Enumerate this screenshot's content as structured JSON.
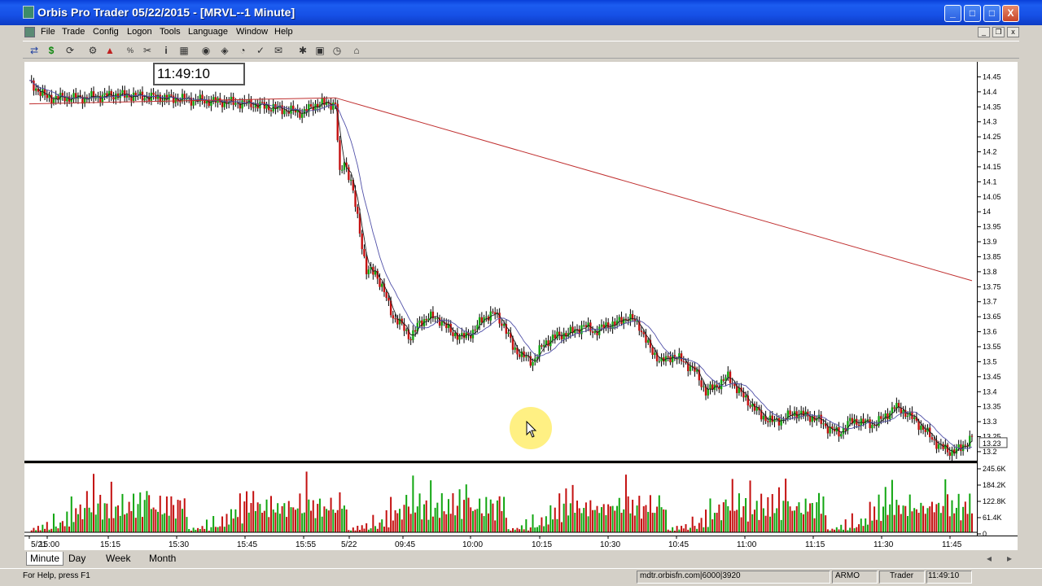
{
  "window": {
    "title": "Orbis Pro Trader  05/22/2015 - [MRVL--1 Minute]",
    "controls": [
      "_",
      "□",
      "X"
    ]
  },
  "menu": {
    "items": [
      "File",
      "Trade",
      "Config",
      "Logon",
      "Tools",
      "Language",
      "Window",
      "Help"
    ]
  },
  "toolbar": {
    "icons": [
      "currency-icon",
      "dollar-icon",
      "refresh-icon",
      "options-icon",
      "chart-up-icon",
      "percent-icon",
      "scissors-icon",
      "info-icon",
      "grid-icon",
      "eye-icon",
      "plot-icon",
      "pie-icon",
      "check-icon",
      "news-icon",
      "tools-icon",
      "layout-icon",
      "clock-icon",
      "home-icon"
    ]
  },
  "clock": "11:49:10",
  "tabs": [
    {
      "label": "Minute",
      "active": true
    },
    {
      "label": "Day",
      "active": false
    },
    {
      "label": "Week",
      "active": false
    },
    {
      "label": "Month",
      "active": false
    }
  ],
  "status": {
    "help": "For Help, press F1",
    "server": "mdtr.orbisfn.com|6000|3920",
    "user": "ARMO",
    "role": "Trader",
    "time": "11:49:10"
  },
  "colors": {
    "up": "#11a611",
    "down": "#c41010",
    "ma_fast": "#202020",
    "ma_mid": "#5050a8",
    "ma_slow": "#c03030"
  },
  "chart_data": {
    "type": "candlestick",
    "symbol": "MRVL",
    "interval": "1 Minute",
    "y_ticks": [
      "14.45",
      "14.4",
      "14.35",
      "14.3",
      "14.25",
      "14.2",
      "14.15",
      "14.1",
      "14.05",
      "14",
      "13.95",
      "13.9",
      "13.85",
      "13.8",
      "13.75",
      "13.7",
      "13.65",
      "13.6",
      "13.55",
      "13.5",
      "13.45",
      "13.4",
      "13.35",
      "13.3",
      "13.25",
      "13.2"
    ],
    "ylim": [
      13.17,
      14.5
    ],
    "last_price": "13.23",
    "volume_ticks": [
      "245.6K",
      "184.2K",
      "122.8K",
      "61.4K",
      "0"
    ],
    "x_ticks": [
      "5/21",
      "15:00",
      "15:15",
      "15:30",
      "15:45",
      "15:55",
      "5/22",
      "09:45",
      "10:00",
      "10:15",
      "10:30",
      "10:45",
      "11:00",
      "11:15",
      "11:30",
      "11:45"
    ],
    "close_path": [
      [
        0,
        14.43
      ],
      [
        8,
        14.38
      ],
      [
        25,
        14.38
      ],
      [
        40,
        14.39
      ],
      [
        60,
        14.38
      ],
      [
        80,
        14.37
      ],
      [
        100,
        14.36
      ],
      [
        115,
        14.34
      ],
      [
        123,
        14.33
      ],
      [
        130,
        14.36
      ],
      [
        138,
        14.36
      ],
      [
        140,
        14.12
      ],
      [
        142,
        14.17
      ],
      [
        145,
        14.1
      ],
      [
        148,
        13.98
      ],
      [
        152,
        13.8
      ],
      [
        156,
        13.8
      ],
      [
        160,
        13.73
      ],
      [
        164,
        13.65
      ],
      [
        168,
        13.62
      ],
      [
        172,
        13.58
      ],
      [
        176,
        13.63
      ],
      [
        180,
        13.65
      ],
      [
        185,
        13.64
      ],
      [
        190,
        13.6
      ],
      [
        195,
        13.58
      ],
      [
        200,
        13.6
      ],
      [
        205,
        13.65
      ],
      [
        210,
        13.66
      ],
      [
        214,
        13.62
      ],
      [
        218,
        13.55
      ],
      [
        222,
        13.52
      ],
      [
        227,
        13.5
      ],
      [
        232,
        13.56
      ],
      [
        236,
        13.58
      ],
      [
        240,
        13.59
      ],
      [
        245,
        13.6
      ],
      [
        250,
        13.62
      ],
      [
        255,
        13.6
      ],
      [
        260,
        13.62
      ],
      [
        265,
        13.63
      ],
      [
        270,
        13.65
      ],
      [
        275,
        13.62
      ],
      [
        280,
        13.54
      ],
      [
        285,
        13.5
      ],
      [
        290,
        13.52
      ],
      [
        295,
        13.5
      ],
      [
        300,
        13.47
      ],
      [
        305,
        13.4
      ],
      [
        310,
        13.42
      ],
      [
        315,
        13.45
      ],
      [
        320,
        13.4
      ],
      [
        325,
        13.36
      ],
      [
        330,
        13.32
      ],
      [
        335,
        13.3
      ],
      [
        340,
        13.31
      ],
      [
        345,
        13.33
      ],
      [
        350,
        13.32
      ],
      [
        355,
        13.31
      ],
      [
        360,
        13.28
      ],
      [
        365,
        13.26
      ],
      [
        370,
        13.3
      ],
      [
        375,
        13.3
      ],
      [
        380,
        13.29
      ],
      [
        385,
        13.31
      ],
      [
        390,
        13.35
      ],
      [
        395,
        13.33
      ],
      [
        400,
        13.3
      ],
      [
        405,
        13.26
      ],
      [
        410,
        13.22
      ],
      [
        415,
        13.2
      ],
      [
        420,
        13.21
      ],
      [
        425,
        13.25
      ]
    ],
    "ma_slow_path": [
      [
        0,
        14.36
      ],
      [
        138,
        14.38
      ],
      [
        425,
        13.77
      ]
    ],
    "volume_levels": [
      0.05,
      0.03,
      0.08,
      0.04,
      0.1,
      0.05,
      0.12,
      0.06,
      0.2,
      0.04,
      0.08,
      0.3,
      0.1,
      0.08,
      0.15,
      0.25,
      0.1,
      0.35,
      0.12,
      0.55,
      0.22,
      0.4,
      0.3,
      0.6,
      0.2,
      0.5,
      0.7,
      0.4,
      0.45,
      0.9,
      0.35,
      0.5,
      0.6,
      0.3,
      0.45,
      0.55,
      0.25,
      0.8,
      0.35,
      0.4,
      0.5,
      0.3,
      0.6,
      0.45,
      0.3,
      0.55,
      0.4,
      0.6,
      0.35,
      0.45,
      0.7,
      0.3,
      0.5,
      0.95,
      0.6,
      0.4,
      0.5,
      0.35,
      0.45,
      0.6,
      0.3,
      0.4,
      0.55,
      0.35,
      0.6,
      0.45,
      0.3,
      0.5,
      0.65,
      0.4,
      0.55,
      0.35
    ]
  }
}
